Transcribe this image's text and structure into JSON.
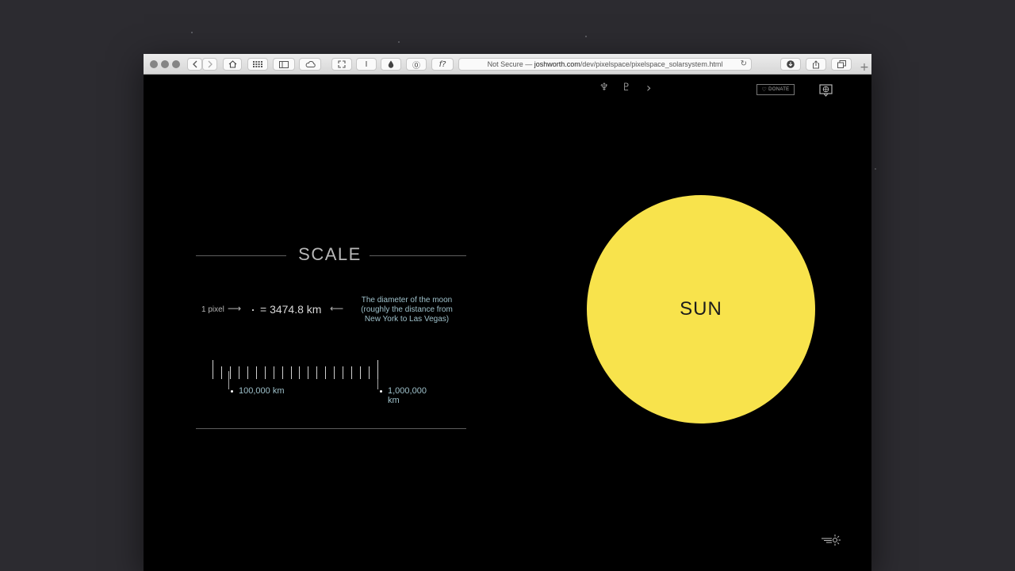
{
  "browser": {
    "address_prefix": "Not Secure — ",
    "address_host": "joshworth.com",
    "address_path": "/dev/pixelspace/pixelspace_solarsystem.html",
    "reload_glyph": "↻",
    "new_tab_glyph": "+",
    "buttons": {
      "reader": "I",
      "password": "⓪",
      "format": "f?"
    }
  },
  "nav": {
    "neptune_glyph": "♆",
    "pluto_glyph": "♇",
    "next_glyph": "›",
    "donate_heart": "♡",
    "donate_label": "DONATE"
  },
  "scale": {
    "title": "SCALE",
    "pixel_label": "1 pixel",
    "arrow_right": "⟶",
    "km_value": "= 3474.8 km",
    "arrow_left": "⟵",
    "moon_note_1": "The diameter of the moon",
    "moon_note_2": "(roughly the distance from",
    "moon_note_3": "New York to Las Vegas)",
    "ruler_small": "100,000 km",
    "ruler_large": "1,000,000 km",
    "small_ticks_count": 18
  },
  "sun": {
    "label": "SUN",
    "color": "#f8e34c"
  },
  "colors": {
    "desktop": "#2c2b30",
    "page": "#000000",
    "accent_text": "#9ec0ca"
  }
}
